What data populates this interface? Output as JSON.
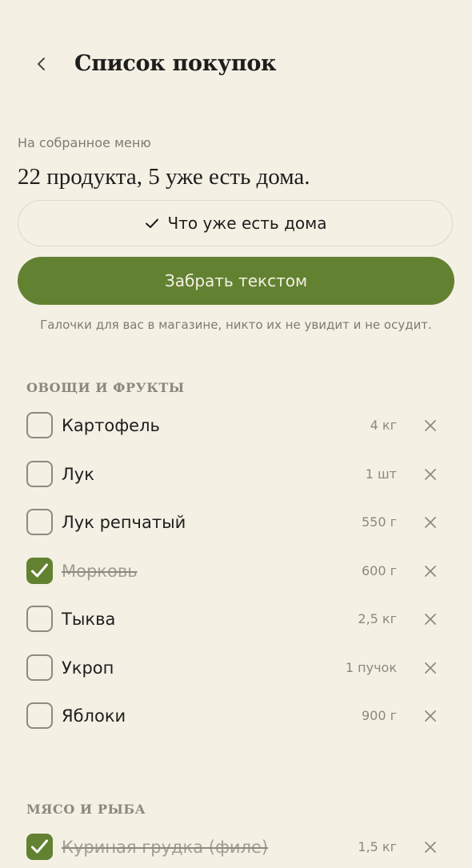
{
  "header": {
    "title": "Список покупок",
    "back_icon": "chevron-left-icon"
  },
  "summary": {
    "caption": "На собранное меню",
    "text": "22 продукта, 5 уже есть дома."
  },
  "buttons": {
    "at_home_label": "Что уже есть дома",
    "at_home_icon": "checkmark-icon",
    "take_text_label": "Забрать текстом"
  },
  "hint": "Галочки для вас в магазине, никто их не увидит и не осудит.",
  "colors": {
    "accent": "#628231",
    "background": "#F4F0E4",
    "muted_text": "#8D887D"
  },
  "sections": [
    {
      "title": "ОВОЩИ И ФРУКТЫ",
      "items": [
        {
          "name": "Картофель",
          "qty": "4 кг",
          "checked": false
        },
        {
          "name": "Лук",
          "qty": "1 шт",
          "checked": false
        },
        {
          "name": "Лук репчатый",
          "qty": "550 г",
          "checked": false
        },
        {
          "name": "Морковь",
          "qty": "600 г",
          "checked": true
        },
        {
          "name": "Тыква",
          "qty": "2,5 кг",
          "checked": false
        },
        {
          "name": "Укроп",
          "qty": "1 пучок",
          "checked": false
        },
        {
          "name": "Яблоки",
          "qty": "900 г",
          "checked": false
        }
      ]
    },
    {
      "title": "МЯСО И РЫБА",
      "items": [
        {
          "name": "Куриная грудка (филе)",
          "qty": "1,5 кг",
          "checked": true
        }
      ]
    }
  ]
}
